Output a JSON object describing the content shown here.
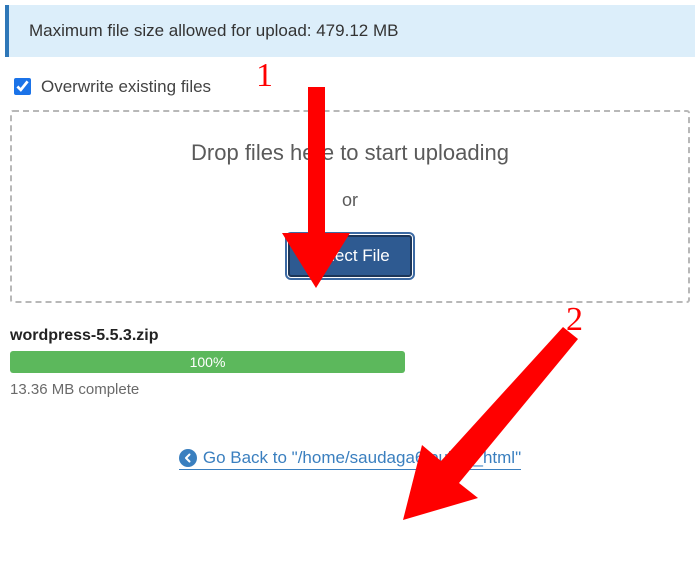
{
  "info_banner": "Maximum file size allowed for upload: 479.12 MB",
  "overwrite_label": "Overwrite existing files",
  "overwrite_checked": true,
  "drop": {
    "title": "Drop files here to start uploading",
    "or": "or",
    "button": "Select File"
  },
  "upload": {
    "filename": "wordpress-5.5.3.zip",
    "progress_percent": "100%",
    "complete_text": "13.36 MB complete"
  },
  "go_back": {
    "text": "Go Back to \"/home/saudaga6/public_html\""
  },
  "annotations": {
    "label1": "1",
    "label2": "2"
  }
}
